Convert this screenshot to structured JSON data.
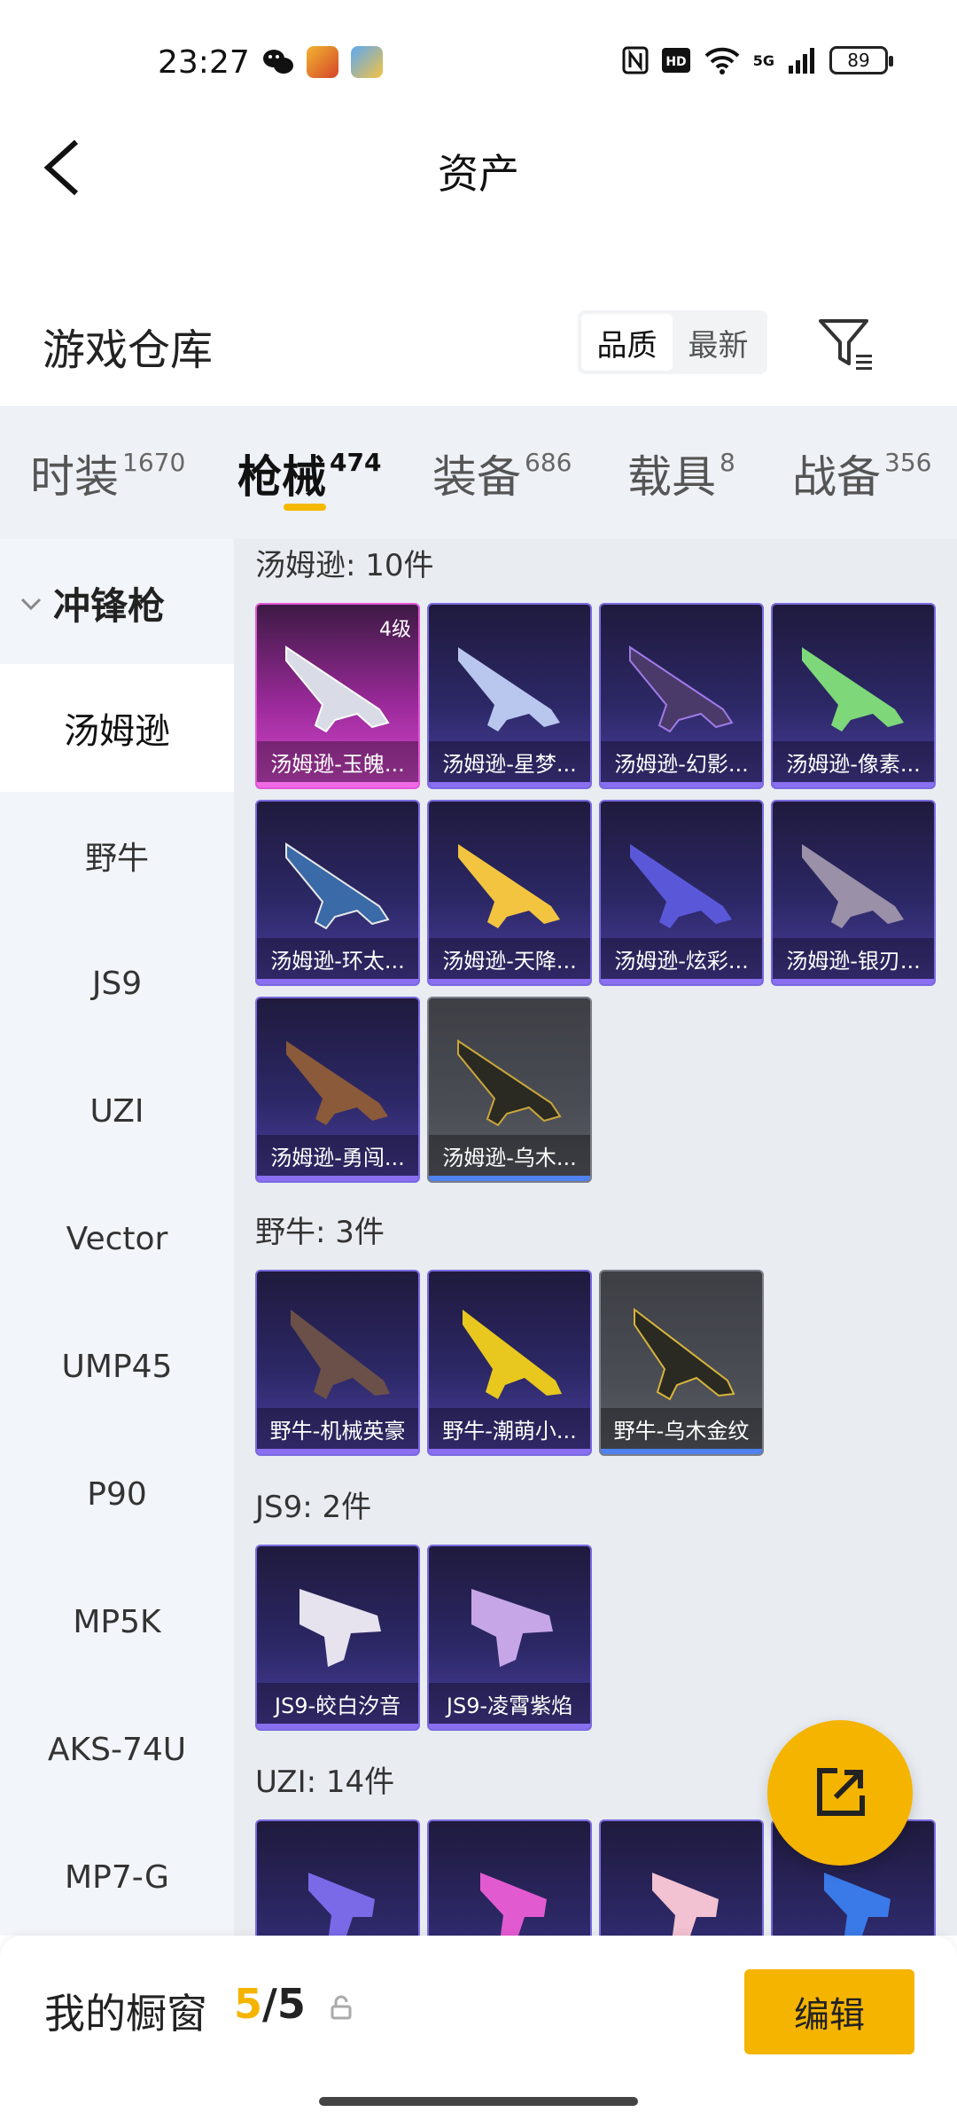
{
  "status_bar": {
    "time": "23:27",
    "battery": "89",
    "network": "5G"
  },
  "header": {
    "title": "资产"
  },
  "warehouse": {
    "title": "游戏仓库",
    "sort_options": [
      "品质",
      "最新"
    ]
  },
  "tabs": [
    {
      "label": "时装",
      "count": "1670"
    },
    {
      "label": "枪械",
      "count": "474"
    },
    {
      "label": "装备",
      "count": "686"
    },
    {
      "label": "载具",
      "count": "8"
    },
    {
      "label": "战备",
      "count": "356"
    }
  ],
  "sidebar": {
    "group": "冲锋枪",
    "items": [
      "汤姆逊",
      "野牛",
      "JS9",
      "UZI",
      "Vector",
      "UMP45",
      "P90",
      "MP5K",
      "AKS-74U",
      "MP7-G"
    ]
  },
  "groups": [
    {
      "title": "汤姆逊: 10件",
      "items": [
        {
          "label": "汤姆逊-玉魄...",
          "badge": "4级"
        },
        {
          "label": "汤姆逊-星梦..."
        },
        {
          "label": "汤姆逊-幻影..."
        },
        {
          "label": "汤姆逊-像素..."
        },
        {
          "label": "汤姆逊-环太..."
        },
        {
          "label": "汤姆逊-天降..."
        },
        {
          "label": "汤姆逊-炫彩..."
        },
        {
          "label": "汤姆逊-银刃..."
        },
        {
          "label": "汤姆逊-勇闯..."
        },
        {
          "label": "汤姆逊-乌木..."
        }
      ]
    },
    {
      "title": "野牛: 3件",
      "items": [
        {
          "label": "野牛-机械英豪"
        },
        {
          "label": "野牛-潮萌小..."
        },
        {
          "label": "野牛-乌木金纹"
        }
      ]
    },
    {
      "title": "JS9: 2件",
      "items": [
        {
          "label": "JS9-皎白汐音"
        },
        {
          "label": "JS9-凌霄紫焰"
        }
      ]
    },
    {
      "title": "UZI: 14件",
      "items": []
    }
  ],
  "bottom_bar": {
    "title": "我的橱窗",
    "current": "5",
    "separator": "/",
    "total": "5",
    "edit_label": "编辑"
  },
  "colors": {
    "accent": "#f5b400",
    "tab_underline": "#f5b800",
    "card_purple": "#4c3fa0",
    "card_rare": "#d84ad0"
  }
}
